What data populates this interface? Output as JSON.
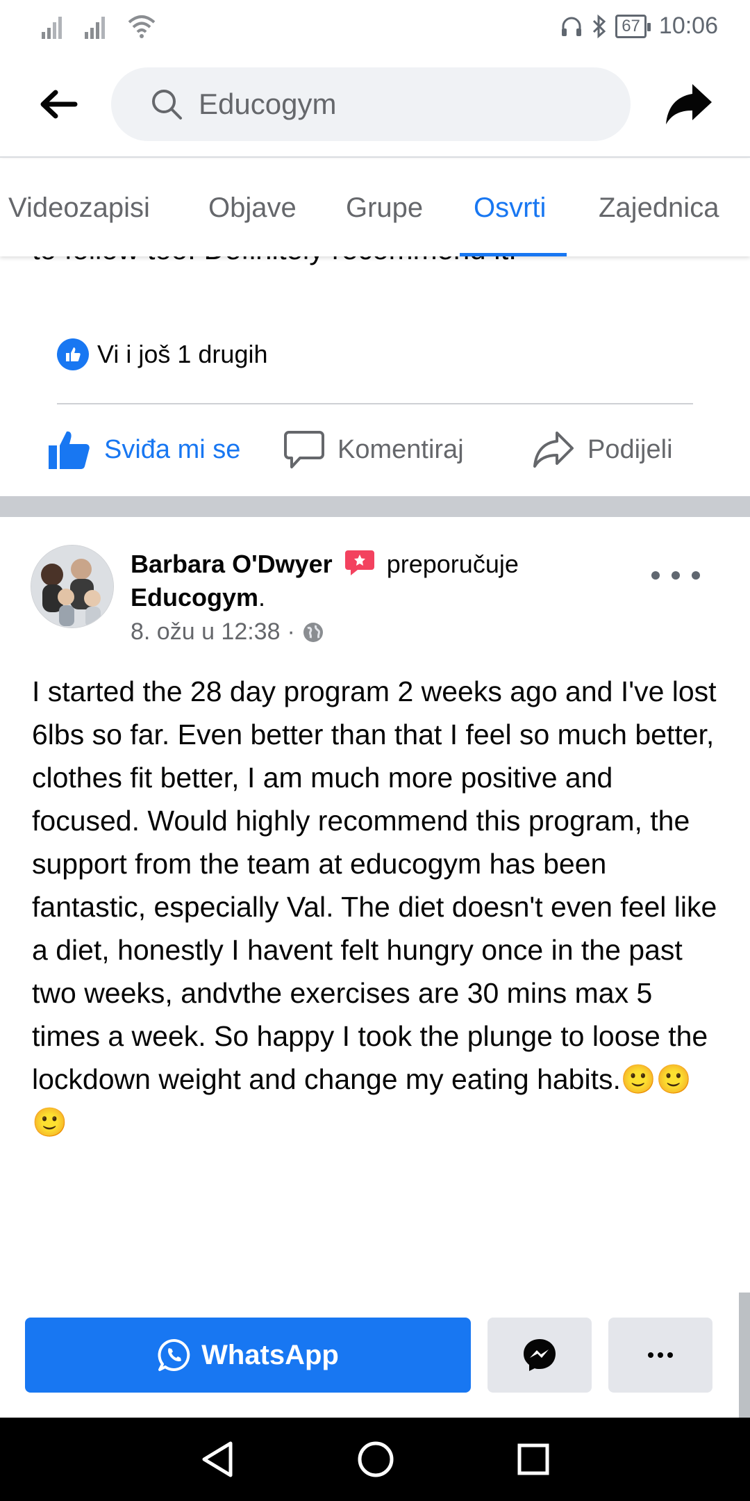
{
  "status_bar": {
    "battery": "67",
    "time": "10:06"
  },
  "header": {
    "search_value": "Educogym"
  },
  "tabs": [
    "Videozapisi",
    "Objave",
    "Grupe",
    "Osvrti",
    "Zajednica"
  ],
  "active_tab": "Osvrti",
  "prev_post": {
    "cut_text": "to follow too. Definitely recommend it.",
    "reactions_text": "Vi i još 1 drugih",
    "actions": {
      "like": "Sviđa mi se",
      "comment": "Komentiraj",
      "share": "Podijeli"
    }
  },
  "post": {
    "author": "Barbara O'Dwyer",
    "recommends": "preporučuje",
    "page": "Educogym",
    "page_suffix": ".",
    "timestamp": "8. ožu u 12:38",
    "meta_separator": "·",
    "body": "I started the 28 day program 2 weeks ago and I've lost 6lbs so far. Even better than that I feel so much better, clothes fit better, I am much more positive and focused. Would highly recommend this program, the support from the team at educogym has been fantastic, especially Val. The diet doesn't even feel like a diet, honestly I havent felt hungry once in the past two weeks, andvthe exercises are 30 mins max 5 times a week. So happy I took the plunge to loose the lockdown weight and change my eating habits.🙂🙂🙂"
  },
  "share_bar": {
    "whatsapp_label": "WhatsApp"
  },
  "colors": {
    "accent": "#1877f2",
    "recommend_badge": "#f3425f",
    "text": "#050505",
    "secondary": "#65676b"
  }
}
